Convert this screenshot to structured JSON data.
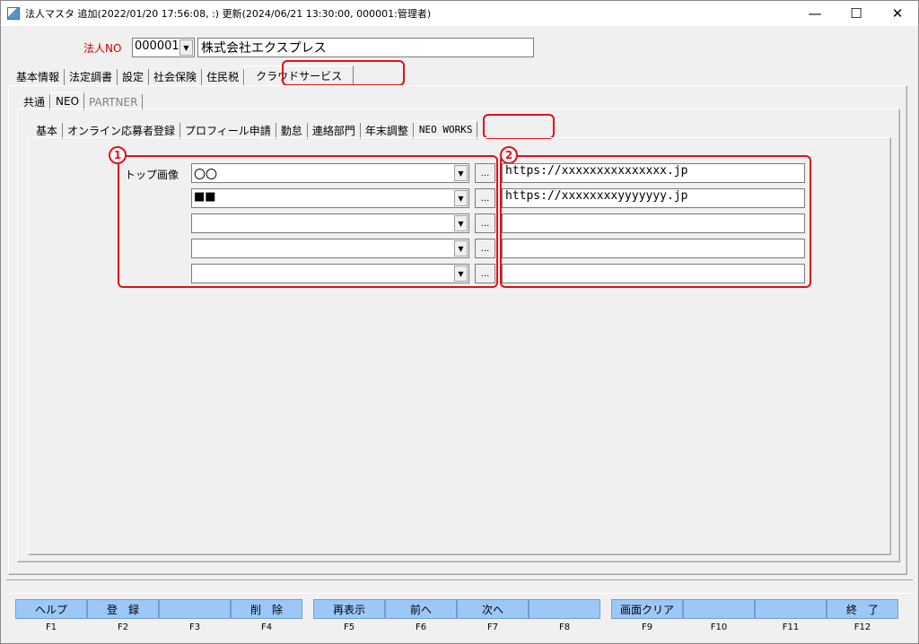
{
  "window": {
    "title": "法人マスタ 追加(2022/01/20 17:56:08, :) 更新(2024/06/21 13:30:00, 000001:管理者)",
    "minimize": "—",
    "maximize": "☐",
    "close": "✕"
  },
  "header": {
    "corp_no_label": "法人NO",
    "corp_no_value": "000001",
    "corp_name": "株式会社エクスプレス"
  },
  "tabs_main": [
    "基本情報",
    "法定調書",
    "設定",
    "社会保険",
    "住民税",
    "クラウドサービス"
  ],
  "tabs_service": [
    "共通",
    "NEO",
    "PARTNER"
  ],
  "tabs_neo": [
    "基本",
    "オンライン応募者登録",
    "プロフィール申請",
    "勤怠",
    "連絡部門",
    "年末調整",
    "NEO WORKS"
  ],
  "neo_works": {
    "top_image_label": "トップ画像",
    "badge1": "1",
    "badge2": "2",
    "browse_label": "...",
    "rows": [
      {
        "image": "〇〇",
        "url": "https://xxxxxxxxxxxxxxx.jp"
      },
      {
        "image": "■■",
        "url": "https://xxxxxxxxyyyyyyy.jp"
      },
      {
        "image": "",
        "url": ""
      },
      {
        "image": "",
        "url": ""
      },
      {
        "image": "",
        "url": ""
      }
    ]
  },
  "fkeys": [
    {
      "label": "ヘルプ",
      "key": "F1"
    },
    {
      "label": "登　録",
      "key": "F2"
    },
    {
      "label": "",
      "key": "F3"
    },
    {
      "label": "削　除",
      "key": "F4"
    },
    {
      "label": "再表示",
      "key": "F5"
    },
    {
      "label": "前へ",
      "key": "F6"
    },
    {
      "label": "次へ",
      "key": "F7"
    },
    {
      "label": "",
      "key": "F8"
    },
    {
      "label": "画面クリア",
      "key": "F9"
    },
    {
      "label": "",
      "key": "F10"
    },
    {
      "label": "",
      "key": "F11"
    },
    {
      "label": "終　了",
      "key": "F12"
    }
  ],
  "colors": {
    "accent_red": "#e0101a",
    "fkey_blue": "#9cc8f8"
  }
}
